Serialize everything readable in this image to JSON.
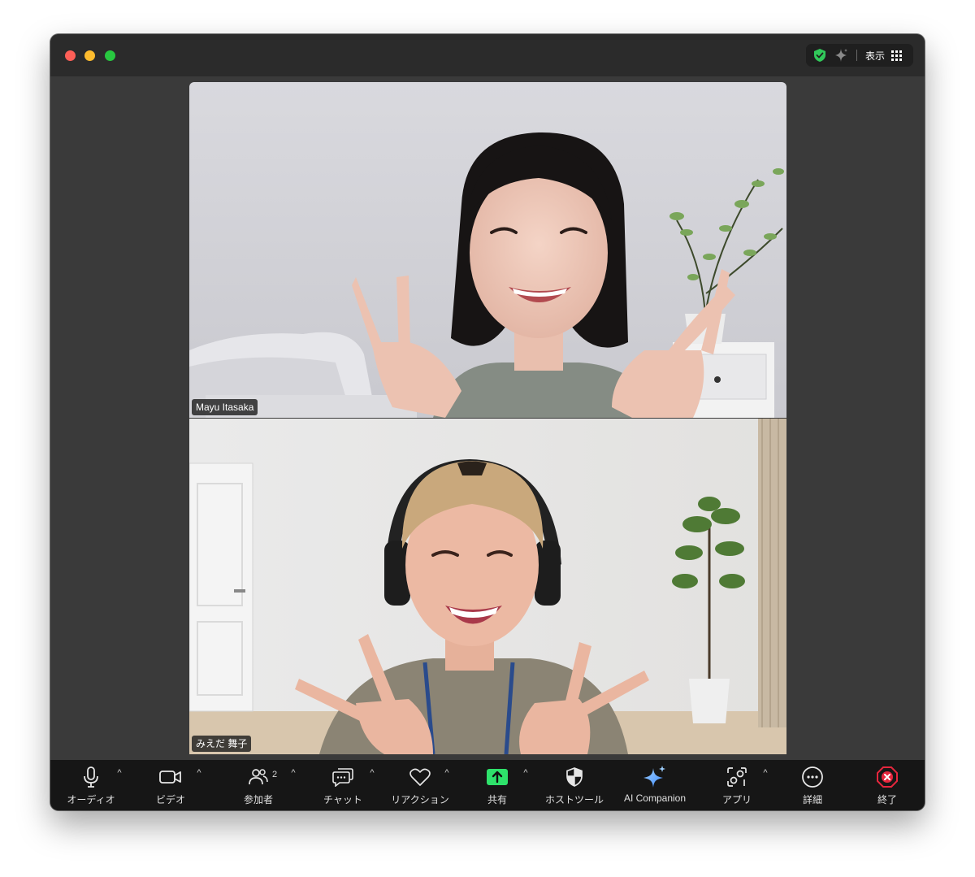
{
  "window": {
    "top_right": {
      "view_label": "表示"
    }
  },
  "participants": [
    {
      "name": "Mayu Itasaka"
    },
    {
      "name": "みえだ 舞子"
    }
  ],
  "toolbar": {
    "audio": {
      "label": "オーディオ"
    },
    "video": {
      "label": "ビデオ"
    },
    "participants": {
      "label": "参加者",
      "count": "2"
    },
    "chat": {
      "label": "チャット"
    },
    "reaction": {
      "label": "リアクション"
    },
    "share": {
      "label": "共有"
    },
    "host_tools": {
      "label": "ホストツール"
    },
    "ai_companion": {
      "label": "AI Companion"
    },
    "apps": {
      "label": "アプリ"
    },
    "more": {
      "label": "詳細"
    },
    "end": {
      "label": "終了"
    }
  },
  "colors": {
    "share_green": "#2ee26b",
    "end_red": "#e5263d",
    "ai_blue": "#5aa7ff",
    "shield_green": "#31c95a"
  }
}
